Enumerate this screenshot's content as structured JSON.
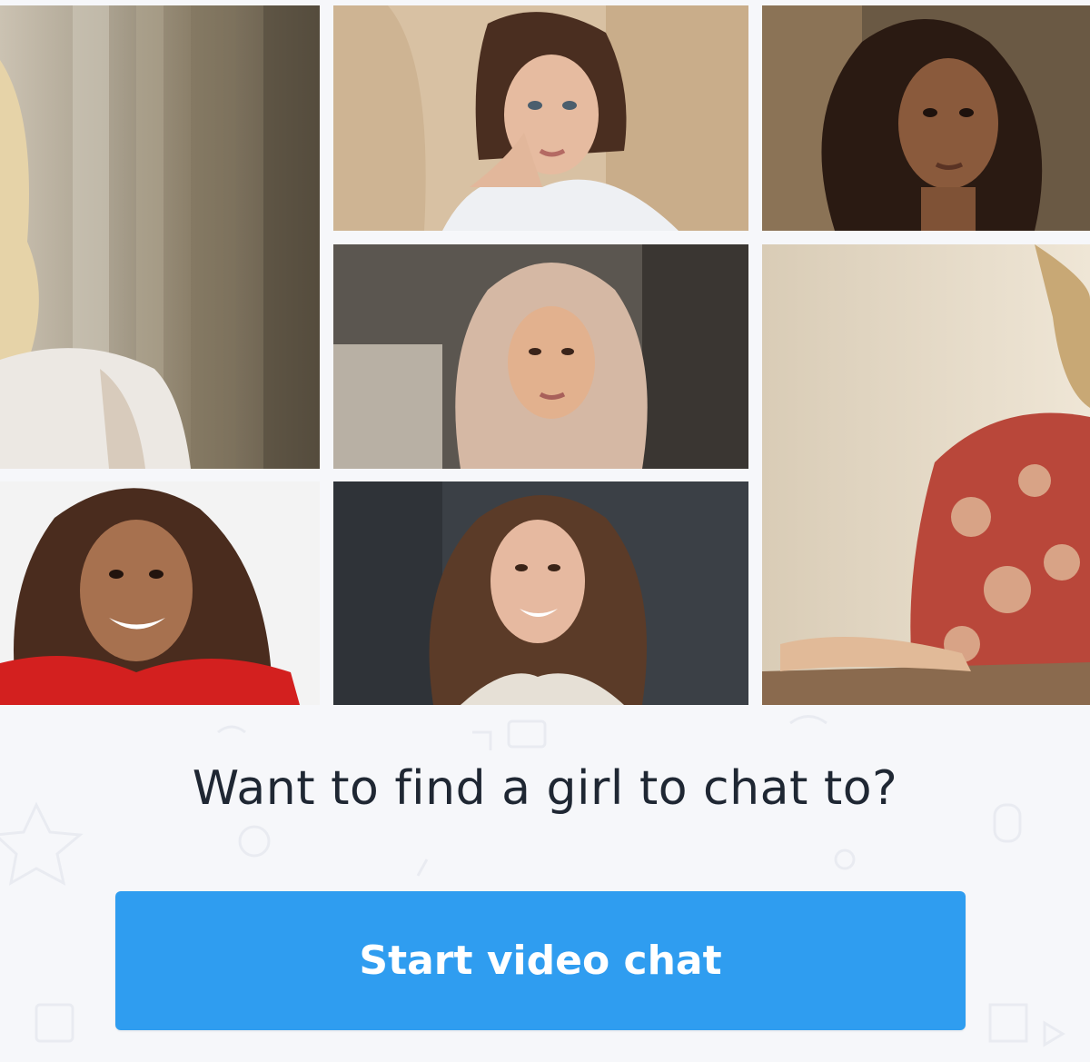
{
  "promo": {
    "headline": "Want to find a girl to chat to?",
    "cta_label": "Start video chat"
  },
  "colors": {
    "background": "#f6f7fa",
    "cta_bg": "#2f9df0",
    "cta_text": "#ffffff",
    "headline_text": "#1f2733"
  }
}
